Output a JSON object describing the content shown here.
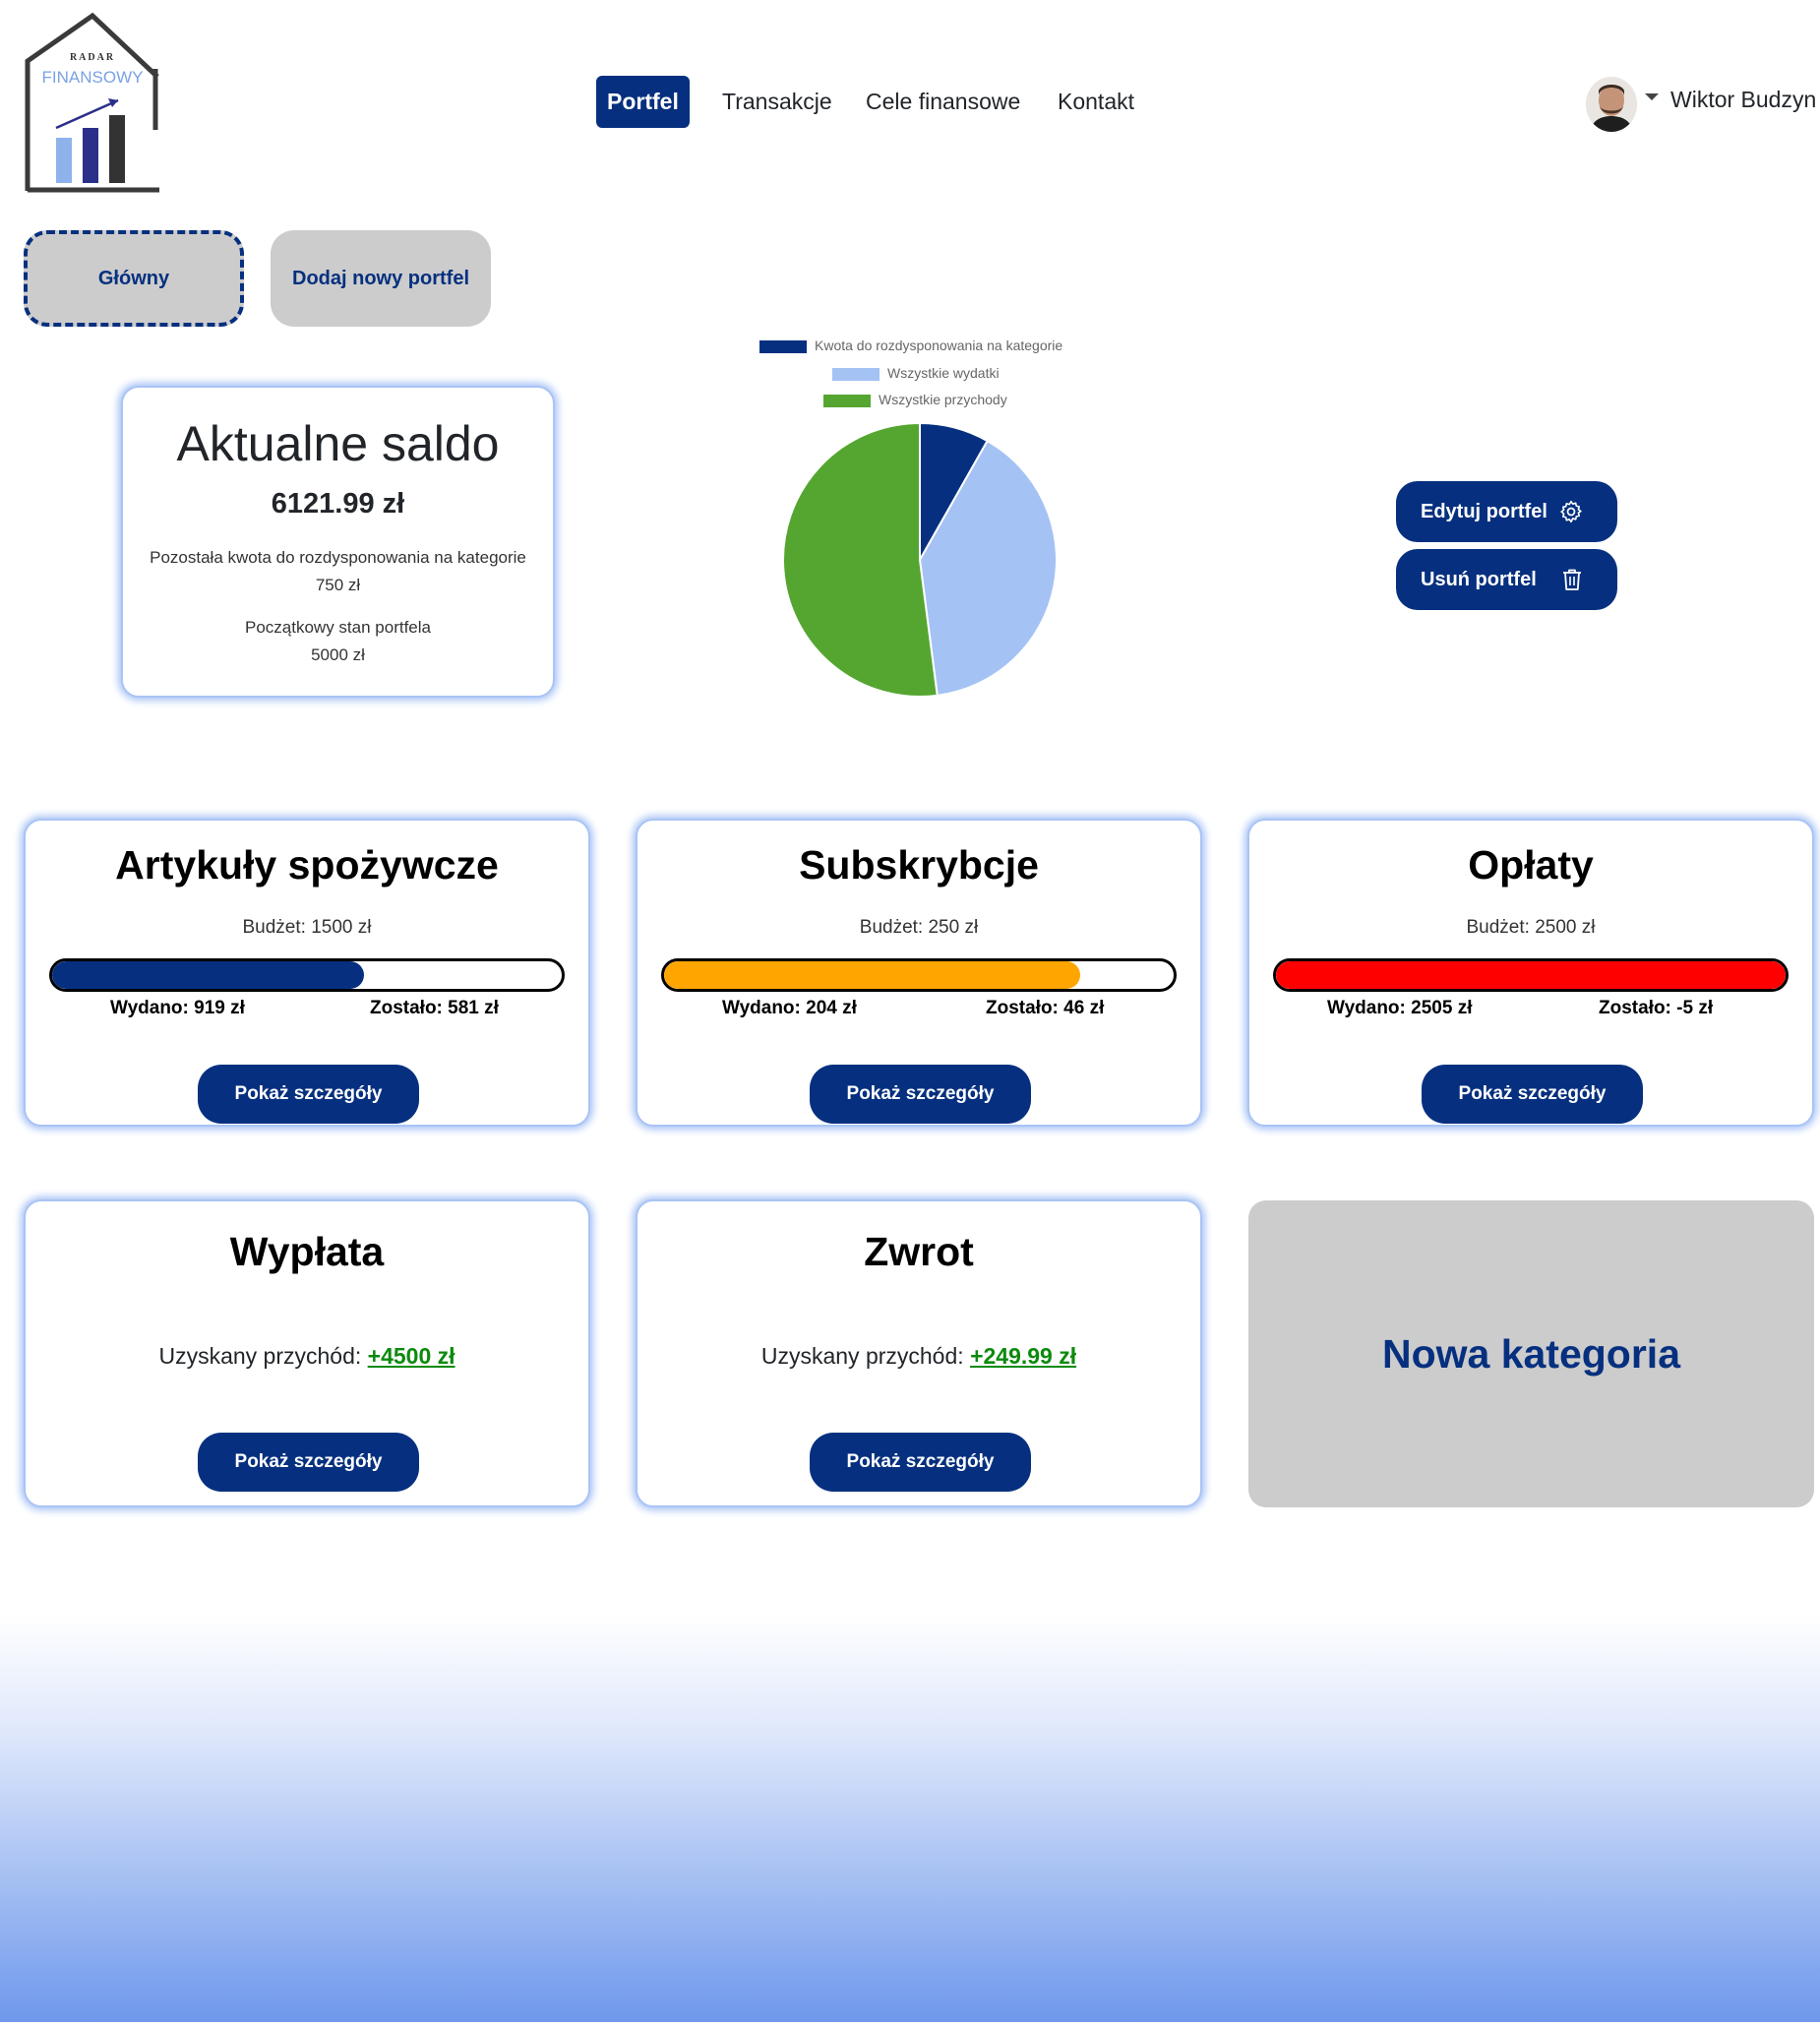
{
  "logo": {
    "top_text": "RADAR",
    "brand_text": "FINANSOWY"
  },
  "nav": [
    {
      "label": "Portfel",
      "active": true
    },
    {
      "label": "Transakcje",
      "active": false
    },
    {
      "label": "Cele finansowe",
      "active": false
    },
    {
      "label": "Kontakt",
      "active": false
    }
  ],
  "user": {
    "name": "Wiktor Budzyn"
  },
  "wallets": {
    "main": "Główny",
    "add": "Dodaj nowy portfel"
  },
  "balance": {
    "title": "Aktualne saldo",
    "amount": "6121.99 zł",
    "remaining_label": "Pozostała kwota do rozdysponowania na kategorie",
    "remaining_value": "750 zł",
    "initial_label": "Początkowy stan portfela",
    "initial_value": "5000 zł"
  },
  "chart_data": {
    "type": "pie",
    "labels": [
      "Kwota do rozdysponowania na kategorie",
      "Wszystkie wydatki",
      "Wszystkie przychody"
    ],
    "values": [
      750,
      3628,
      4749.99
    ],
    "colors": [
      "#06307f",
      "#a4c2f4",
      "#55a630"
    ],
    "legend": "top"
  },
  "actions": {
    "edit": "Edytuj portfel",
    "delete": "Usuń portfel"
  },
  "categories": [
    {
      "title": "Artykuły spożywcze",
      "budget": "Budżet: 1500 zł",
      "spent": "Wydano: 919 zł",
      "left": "Zostało: 581 zł",
      "fill": 0.6127,
      "color": "#06307f",
      "button": "Pokaż szczegóły"
    },
    {
      "title": "Subskrybcje",
      "budget": "Budżet: 250 zł",
      "spent": "Wydano: 204 zł",
      "left": "Zostało: 46 zł",
      "fill": 0.816,
      "color": "#ffa500",
      "button": "Pokaż szczegóły"
    },
    {
      "title": "Opłaty",
      "budget": "Budżet: 2500 zł",
      "spent": "Wydano: 2505 zł",
      "left": "Zostało: -5 zł",
      "fill": 1.0,
      "color": "#ff0000",
      "button": "Pokaż szczegóły"
    }
  ],
  "incomes": [
    {
      "title": "Wypłata",
      "label": "Uzyskany przychód:",
      "value": "+4500 zł",
      "button": "Pokaż szczegóły"
    },
    {
      "title": "Zwrot",
      "label": "Uzyskany przychód:",
      "value": "+249.99 zł",
      "button": "Pokaż szczegóły"
    }
  ],
  "new_category": "Nowa kategoria"
}
